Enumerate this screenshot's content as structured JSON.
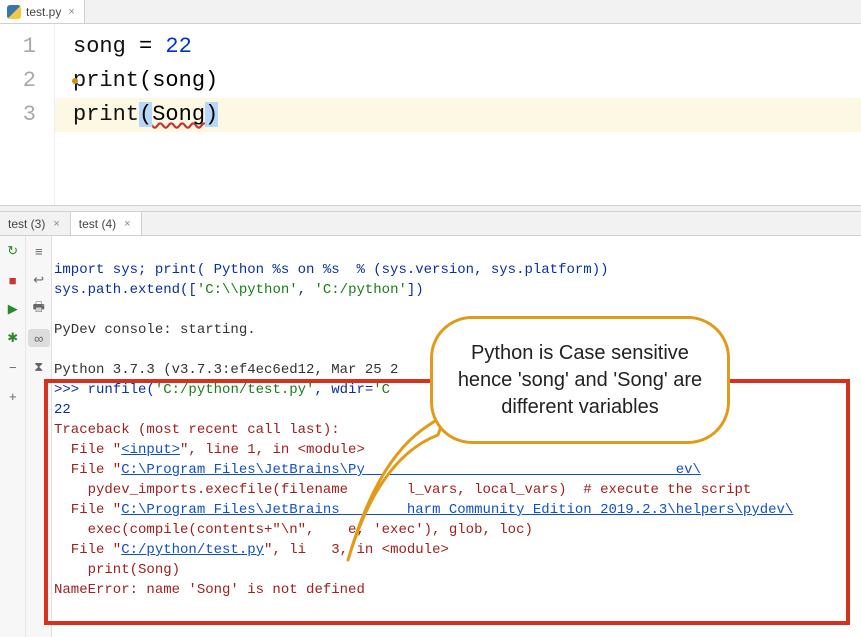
{
  "editor": {
    "tab_name": "test.py",
    "gutter": [
      "1",
      "2",
      "3"
    ],
    "line1": {
      "var": "song",
      "eq": " = ",
      "num": "22"
    },
    "line2": {
      "fn": "print",
      "open": "(",
      "arg": "song",
      "close": ")"
    },
    "line3": {
      "fn": "print",
      "open": "(",
      "arg": "Song",
      "close": ")"
    }
  },
  "console_tabs": {
    "tab1": "test (3)",
    "tab2": "test (4)"
  },
  "toolbar": {
    "rerun": "↻",
    "stop": "■",
    "run": "▶",
    "bug": "✱",
    "minus": "−",
    "plus": "+",
    "filter": "≡",
    "wrap": "↩",
    "print": "🖶",
    "oo": "∞",
    "clock": "⧗"
  },
  "console": {
    "l0a": "import sys; print( Python %s on %s  % (sys.version, sys.platform))",
    "l1a": "sys.path.extend([",
    "l1b": "'C:\\\\python'",
    "l1c": ", ",
    "l1d": "'C:/python'",
    "l1e": "])",
    "l3": "PyDev console: starting.",
    "l5a": "Python 3.7.3 (v3.7.3:ef4ec6ed12, Mar 25 2",
    "l6a": ">>> ",
    "l6b": "runfile(",
    "l6c": "'C:/python/test.py'",
    "l6d": ", wdir=",
    "l6e": "'C",
    "l7": "22",
    "l8": "Traceback (most recent call last):",
    "l9a": "  File \"",
    "l9b": "<input>",
    "l9c": "\", line 1, in <module>",
    "l10a": "  File \"",
    "l10b": "C:\\Program Files\\JetBrains\\Py",
    "l10c": "                                     ev\\",
    "l11": "    pydev_imports.execfile(filename       l_vars, local_vars)  # execute the script",
    "l12a": "  File \"",
    "l12b": "C:\\Program Files\\JetBrains        harm Community Edition 2019.2.3\\helpers\\pydev\\",
    "l13": "    exec(compile(contents+\"\\n\",    e, 'exec'), glob, loc)",
    "l14a": "  File \"",
    "l14b": "C:/python/test.py",
    "l14c": "\", li   3, in <module>",
    "l15": "    print(Song)",
    "l16": "NameError: name 'Song' is not defined"
  },
  "callout": {
    "text": "Python is Case sensitive hence 'song' and 'Song' are different variables"
  }
}
